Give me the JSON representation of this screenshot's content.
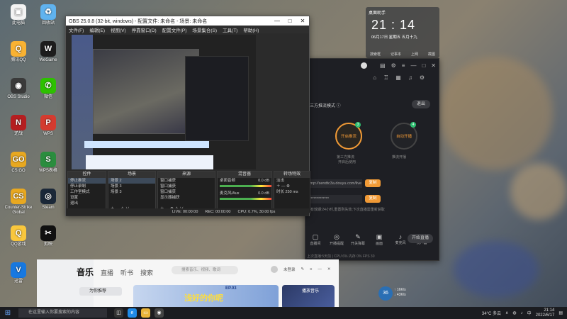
{
  "desktop": {
    "icons": [
      {
        "label": "此电脑",
        "color": "#f3f3f3",
        "glyph": "▣"
      },
      {
        "label": "回收站",
        "color": "#60b3ef",
        "glyph": "♻"
      },
      {
        "label": "腾讯QQ",
        "color": "#f9b233",
        "glyph": "Q"
      },
      {
        "label": "WeGame",
        "color": "#1d1d1d",
        "glyph": "W"
      },
      {
        "label": "OBS Studio",
        "color": "#3a3a3a",
        "glyph": "◉"
      },
      {
        "label": "微信",
        "color": "#2dc100",
        "glyph": "✆"
      },
      {
        "label": "逆战",
        "color": "#b51e20",
        "glyph": "N"
      },
      {
        "label": "WPS",
        "color": "#d43b2f",
        "glyph": "P"
      },
      {
        "label": "CS:GO",
        "color": "#e8a820",
        "glyph": "GO"
      },
      {
        "label": "WPS表格",
        "color": "#2a8d3e",
        "glyph": "S"
      },
      {
        "label": "Counter-Strike Global",
        "color": "#e8a820",
        "glyph": "CS"
      },
      {
        "label": "Steam",
        "color": "#1b2838",
        "glyph": "◎"
      },
      {
        "label": "QQ游戏",
        "color": "#f9c73d",
        "glyph": "Q"
      },
      {
        "label": "剪映",
        "color": "#111",
        "glyph": "✂"
      },
      {
        "label": "迅雷",
        "color": "#1778e0",
        "glyph": "V"
      },
      {
        "label": "腾讯视频",
        "color": "#1b9a3f",
        "glyph": "▶"
      }
    ]
  },
  "obs": {
    "title": "OBS 25.0.8 (32-bit, windows) - 配置文件: 未命名 - 场景: 未命名",
    "menu": [
      "文件(F)",
      "编辑(E)",
      "视图(V)",
      "停靠窗口(D)",
      "配置文件(P)",
      "场景集合(S)",
      "工具(T)",
      "帮助(H)"
    ],
    "docks": {
      "controls": {
        "title": "控件",
        "items": [
          "停止推流",
          "停止录制",
          "工作室模式",
          "设置",
          "退出"
        ]
      },
      "scenes": {
        "title": "场景",
        "items": [
          "场景 2",
          "场景 3",
          "场景 3"
        ]
      },
      "sources": {
        "title": "来源",
        "items": [
          "窗口捕获",
          "窗口捕获",
          "窗口捕获",
          "显示器捕获"
        ]
      },
      "mixer": {
        "title": "混音器",
        "items": [
          "桌面音频",
          "麦克风/Aux"
        ],
        "levels": [
          "0.0 dB",
          "0.0 dB"
        ]
      },
      "transitions": {
        "title": "转场特效",
        "items": [
          "淡出",
          "时长",
          "250 ms"
        ]
      }
    },
    "status": [
      "LIVE: 00:00:00",
      "REC: 00:00:00",
      "CPU: 0.7%, 30.00 fps"
    ]
  },
  "clock_widget": {
    "label": "桌面助手",
    "time": "21 : 14",
    "date": "06月17日  星期五  五月十九",
    "items": [
      "搜索框",
      "记事本",
      "上网",
      "截图"
    ]
  },
  "live_app": {
    "mode": "第三方推流模式",
    "exit": "退出",
    "option_a": "开启推流",
    "option_a_caption": "第三方推流",
    "option_a_sub": "开启后使用",
    "option_b": "自动开播",
    "option_b_caption": "推流开播",
    "badges": [
      "3",
      "4"
    ],
    "fields": [
      "rtmp://sendtc3a.douyu.com/live",
      "**************"
    ],
    "copy_label": "复制",
    "copy_label_2": "复制",
    "hint": "码有效期:24小时,重置则失效;下次直播需重新获取",
    "tools": [
      {
        "icon": "▢",
        "label": "直播间"
      },
      {
        "icon": "◎",
        "label": "开播提醒"
      },
      {
        "icon": "✎",
        "label": "开关弹幕"
      },
      {
        "icon": "▣",
        "label": "画面"
      },
      {
        "icon": "♪",
        "label": "麦克风"
      },
      {
        "icon": "♫",
        "label": "扬声器"
      }
    ],
    "start": "开始直播",
    "footer": "上次直播:5天前  |  CPU 6%  内存 0%  FPS 30",
    "left_items": [
      "投放画面",
      "上传视频",
      "导出设置",
      "生成直播时段"
    ]
  },
  "music": {
    "nav": [
      "音乐",
      "直播",
      "听书",
      "搜索"
    ],
    "search_placeholder": "搜索音乐、视频、歌词",
    "user": "未登录",
    "selected": "为你推荐",
    "banner_text": "浅好的你呢",
    "banner_label": "EP.03",
    "banner2": "播放音乐"
  },
  "taskbar": {
    "search": "在这里输入你要搜索的内容",
    "temp": "34°C 多云",
    "ime": "中",
    "time": "21:14",
    "date": "2022/6/17"
  },
  "speed": {
    "value": "36",
    "up": "↑ 16K/s",
    "down": "↓ 43K/s"
  }
}
